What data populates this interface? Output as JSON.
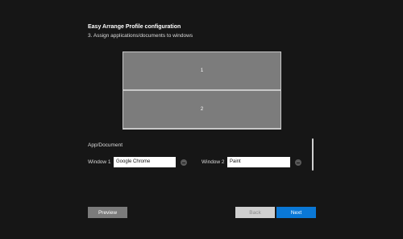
{
  "header": {
    "title": "Easy Arrange Profile configuration",
    "step": "3. Assign applications/documents to windows"
  },
  "layout_preview": {
    "zones": [
      {
        "label": "1"
      },
      {
        "label": "2"
      }
    ]
  },
  "assignments": {
    "section_label": "App/Document",
    "windows": [
      {
        "label": "Window 1",
        "value": "Google Chrome"
      },
      {
        "label": "Window 2",
        "value": "Paint"
      }
    ]
  },
  "footer": {
    "preview_label": "Preview",
    "back_label": "Back",
    "next_label": "Next"
  },
  "colors": {
    "background": "#161616",
    "zone_fill": "#7c7c7c",
    "primary_button": "#0a78d6",
    "secondary_button": "#7b7b7b",
    "disabled_button": "#cfcfcf"
  }
}
